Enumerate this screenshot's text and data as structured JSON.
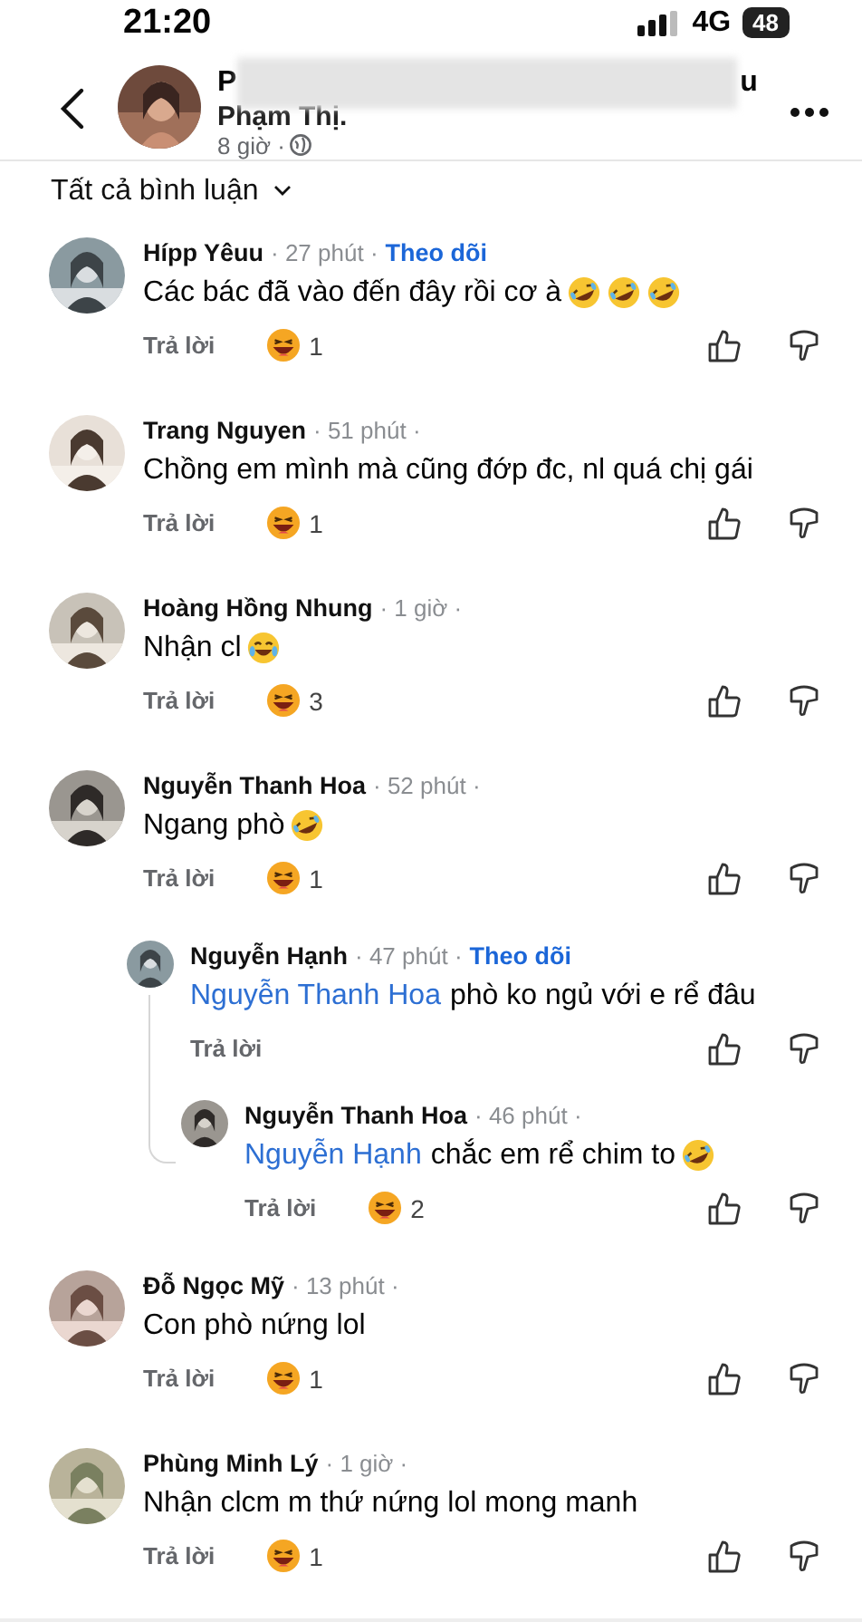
{
  "status_bar": {
    "time": "21:20",
    "network": "4G",
    "battery": "48"
  },
  "post_header": {
    "name_start": "P",
    "name_end": "u",
    "name_line_2": "Phạm Thị.",
    "redacted": true,
    "time": "8 giờ ·"
  },
  "filter": {
    "label": "Tất cả bình luận"
  },
  "comments": [
    {
      "name": "Hípp Yêuu",
      "meta": "· 27 phút ·",
      "follow": "Theo dõi",
      "text": "Các bác đã vào đến đây rồi cơ à",
      "emojis": [
        {
          "kind": "rofl"
        },
        {
          "kind": "rofl"
        },
        {
          "kind": "rofl"
        }
      ],
      "reply": "Trả lời",
      "reaction_count": "1"
    },
    {
      "name": "Trang Nguyen",
      "meta": "· 51 phút ·",
      "text": "Chồng em mình mà cũng đớp đc, nl quá chị gái",
      "reply": "Trả lời",
      "reaction_count": "1"
    },
    {
      "name": "Hoàng Hồng Nhung",
      "meta": "· 1 giờ ·",
      "text": "Nhận cl",
      "emojis": [
        {
          "kind": "joy"
        }
      ],
      "reply": "Trả lời",
      "reaction_count": "3"
    },
    {
      "name": "Nguyễn Thanh Hoa",
      "meta": "· 52 phút ·",
      "text": "Ngang phò",
      "emojis": [
        {
          "kind": "rofl"
        }
      ],
      "reply": "Trả lời",
      "reaction_count": "1",
      "children": [
        {
          "name": "Nguyễn Hạnh",
          "meta": "· 47 phút ·",
          "follow": "Theo dõi",
          "mention": "Nguyễn Thanh Hoa",
          "text": "phò ko ngủ với e rể đâu",
          "reply": "Trả lời",
          "children": [
            {
              "name": "Nguyễn Thanh Hoa",
              "meta": "· 46 phút ·",
              "mention": "Nguyễn Hạnh",
              "text": "chắc em rể chim to",
              "emojis": [
                {
                  "kind": "rofl"
                }
              ],
              "reply": "Trả lời",
              "reaction_count": "2"
            }
          ]
        }
      ]
    },
    {
      "name": "Đỗ Ngọc Mỹ",
      "meta": "· 13 phút ·",
      "text": "Con phò nứng lol",
      "reply": "Trả lời",
      "reaction_count": "1"
    },
    {
      "name": "Phùng Minh Lý",
      "meta": "· 1 giờ ·",
      "text": "Nhận clcm m thứ nứng lol mong manh",
      "reply": "Trả lời",
      "reaction_count": "1"
    }
  ]
}
